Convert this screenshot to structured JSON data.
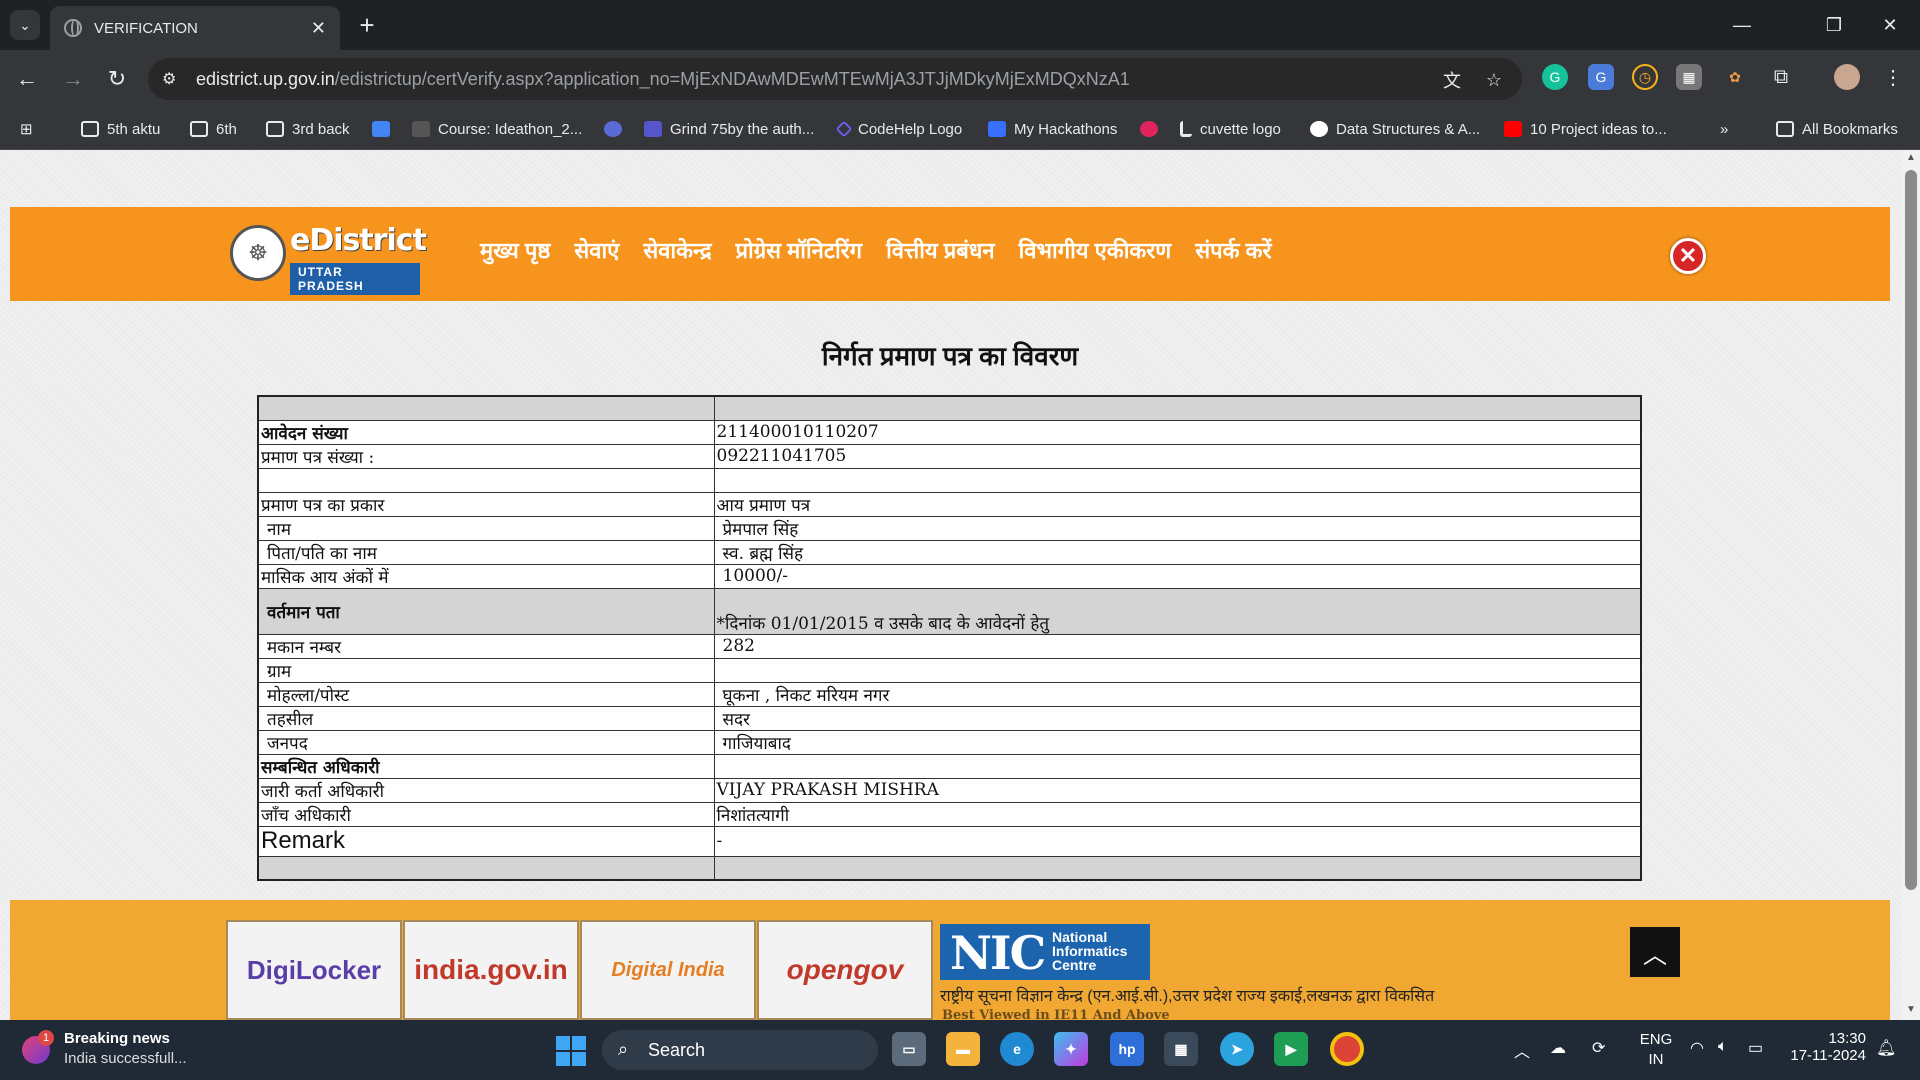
{
  "browser": {
    "tab_title": "VERIFICATION",
    "url_host": "edistrict.up.gov.in",
    "url_path": "/edistrictup/certVerify.aspx?application_no=MjExNDAwMDEwMTEwMjA3JTJjMDkyMjExMDQxNzA1",
    "bookmarks": [
      {
        "label": "5th aktu",
        "icon": "folder-icon"
      },
      {
        "label": "6th",
        "icon": "folder-icon"
      },
      {
        "label": "3rd back",
        "icon": "folder-icon"
      },
      {
        "label": "",
        "icon": "docs-icon"
      },
      {
        "label": "Course: Ideathon_2...",
        "icon": "course-icon"
      },
      {
        "label": "",
        "icon": "s-icon"
      },
      {
        "label": "Grind 75by the auth...",
        "icon": "grind-icon"
      },
      {
        "label": "CodeHelp Logo",
        "icon": "codehelp-icon"
      },
      {
        "label": "My Hackathons",
        "icon": "devfolio-icon"
      },
      {
        "label": "",
        "icon": "heart-icon"
      },
      {
        "label": "cuvette logo",
        "icon": "cuvette-icon"
      },
      {
        "label": "Data Structures & A...",
        "icon": "google-icon"
      },
      {
        "label": "10 Project ideas to...",
        "icon": "youtube-icon"
      }
    ],
    "all_bookmarks": "All Bookmarks"
  },
  "site": {
    "logo_title": "eDistrict",
    "logo_sub": "UTTAR PRADESH",
    "nav": [
      "मुख्य पृष्ठ",
      "सेवाएं",
      "सेवाकेन्द्र",
      "प्रोग्रेस मॉनिटरिंग",
      "वित्तीय प्रबंधन",
      "विभागीय एकीकरण",
      "संपर्क करें"
    ],
    "heading": "निर्गत प्रमाण पत्र का विवरण"
  },
  "certificate": {
    "rows": [
      {
        "label": "आवेदन संख्या",
        "value": "211400010110207",
        "style": "bold"
      },
      {
        "label": "प्रमाण पत्र संख्या :",
        "value": "092211041705",
        "style": ""
      },
      {
        "label": "",
        "value": "",
        "style": "blank"
      },
      {
        "label": "प्रमाण पत्र का प्रकार",
        "value": "आय प्रमाण पत्र",
        "style": ""
      },
      {
        "label": "नाम",
        "value": "प्रेमपाल सिंह",
        "style": "indent"
      },
      {
        "label": "पिता/पति का नाम",
        "value": "स्व. ब्रह्म सिंह",
        "style": "indent"
      },
      {
        "label": "मासिक आय अंकों में",
        "value": "10000/-",
        "style": "valindent"
      },
      {
        "label": "वर्तमान पता",
        "value": "*दिनांक 01/01/2015 व उसके बाद के आवेदनों हेतु",
        "style": "section"
      },
      {
        "label": "मकान नम्बर",
        "value": "282",
        "style": "indent"
      },
      {
        "label": "ग्राम",
        "value": "",
        "style": "indent"
      },
      {
        "label": "मोहल्ला/पोस्ट",
        "value": "घूकना , निकट मरियम नगर",
        "style": "indent"
      },
      {
        "label": "तहसील",
        "value": "सदर",
        "style": "indent"
      },
      {
        "label": "जनपद",
        "value": "गाजियाबाद",
        "style": "indent"
      },
      {
        "label": "सम्बन्धित अधिकारी",
        "value": "",
        "style": "bold"
      },
      {
        "label": "जारी कर्ता अधिकारी",
        "value": "VIJAY PRAKASH MISHRA",
        "style": ""
      },
      {
        "label": "जाँच अधिकारी",
        "value": "निशांतत्यागी",
        "style": ""
      },
      {
        "label": "Remark",
        "value": "-",
        "style": "remark"
      }
    ]
  },
  "footer": {
    "logos": [
      "DigiLocker",
      "india.gov.in",
      "Digital India",
      "opengov"
    ],
    "nic_big": "NIC",
    "nic_small": "National Informatics Centre",
    "nic_text": "राष्ट्रीय सूचना विज्ञान केन्द्र (एन.आई.सी.),उत्तर प्रदेश राज्य इकाई,लखनऊ द्वारा विकसित",
    "best_viewed": "Best Viewed in IE11 And Above"
  },
  "taskbar": {
    "news_title": "Breaking news",
    "news_sub": "India successfull...",
    "news_badge": "1",
    "search_label": "Search",
    "lang_1": "ENG",
    "lang_2": "IN",
    "time": "13:30",
    "date": "17-11-2024"
  }
}
